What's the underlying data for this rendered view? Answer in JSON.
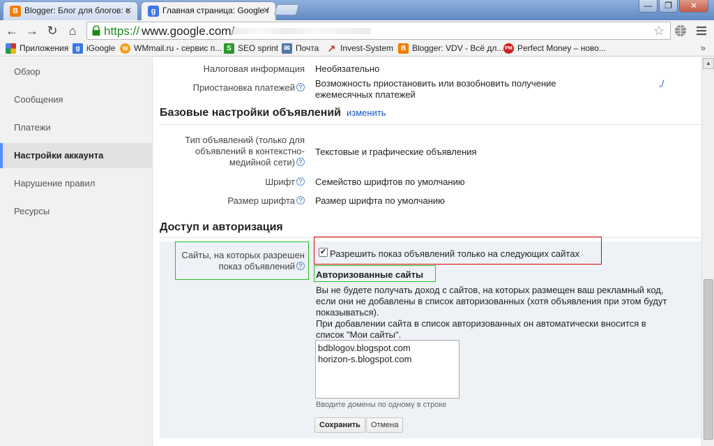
{
  "browser": {
    "tabs": [
      {
        "title": "Blogger: Блог для блогов: с",
        "favicon": "B",
        "active": false
      },
      {
        "title": "Главная страница: Google /",
        "favicon": "g",
        "active": true
      }
    ],
    "window_controls": {
      "minimize": "—",
      "maximize": "❐",
      "close": "✕"
    },
    "url": {
      "scheme": "https://",
      "host": "www.google.com/"
    },
    "bookmarks": [
      {
        "label": "Приложения",
        "icon": "apps-icon",
        "color": "#d93025"
      },
      {
        "label": "iGoogle",
        "icon": "google-icon",
        "color": "#3b78e7"
      },
      {
        "label": "WMmail.ru - сервис п...",
        "icon": "wmmail-icon",
        "color": "#f0a020"
      },
      {
        "label": "SEO sprint",
        "icon": "seo-icon",
        "color": "#2b9a2b"
      },
      {
        "label": "Почта",
        "icon": "mail-icon",
        "color": "#5577aa"
      },
      {
        "label": "Invest-System",
        "icon": "invest-icon",
        "color": "#cc3333"
      },
      {
        "label": "Blogger: VDV - Всё дл...",
        "icon": "blogger-icon",
        "color": "#f57d00"
      },
      {
        "label": "Perfect Money – ново...",
        "icon": "pm-icon",
        "color": "#d11f1f"
      }
    ],
    "bookmarks_more": "»"
  },
  "sidebar": {
    "items": [
      {
        "label": "Обзор"
      },
      {
        "label": "Сообщения"
      },
      {
        "label": "Платежи"
      },
      {
        "label": "Настройки аккаунта",
        "active": true
      },
      {
        "label": "Нарушение правил"
      },
      {
        "label": "Ресурсы"
      }
    ]
  },
  "payments": {
    "tax_label": "Налоговая информация",
    "tax_value": "Необязательно",
    "suspend_label": "Приостановка платежей",
    "suspend_value_line1": "Возможность приостановить или возобновить получение",
    "suspend_value_line2": "ежемесячных платежей",
    "suspend_mark": ",/"
  },
  "ad_settings": {
    "title": "Базовые настройки объявлений",
    "edit_link": "изменить",
    "type_label_line1": "Тип объявлений (только для",
    "type_label_line2": "объявлений в контекстно-",
    "type_label_line3": "медийной сети)",
    "type_value": "Текстовые и графические объявления",
    "font_label": "Шрифт",
    "font_value": "Семейство шрифтов по умолчанию",
    "size_label": "Размер шрифта",
    "size_value": "Размер шрифта по умолчанию"
  },
  "access": {
    "title": "Доступ и авторизация",
    "sites_label_line1": "Сайты, на которых разрешен",
    "sites_label_line2": "показ объявлений",
    "checkbox_label": "Разрешить показ объявлений только на следующих сайтах",
    "checkbox_checked": true,
    "authorized_title": "Авторизованные сайты",
    "desc_line1": "Вы не будете получать доход с сайтов, на которых размещен ваш рекламный код,",
    "desc_line2": "если они не добавлены в список авторизованных (хотя объявления при этом будут",
    "desc_line3": "показываться).",
    "desc_line4": "При добавлении сайта в список авторизованных он автоматически вносится в",
    "desc_line5": "список \"Мои сайты\".",
    "sites": [
      "bdblogov.blogspot.com",
      "horizon-s.blogspot.com"
    ],
    "hint": "Вводите домены по одному в строке",
    "save_label": "Сохранить",
    "cancel_label": "Отмена"
  },
  "colors": {
    "accent_link": "#1155cc",
    "highlight_red": "#dd0000",
    "highlight_green": "#22c222",
    "url_green": "#1b8a1b"
  }
}
